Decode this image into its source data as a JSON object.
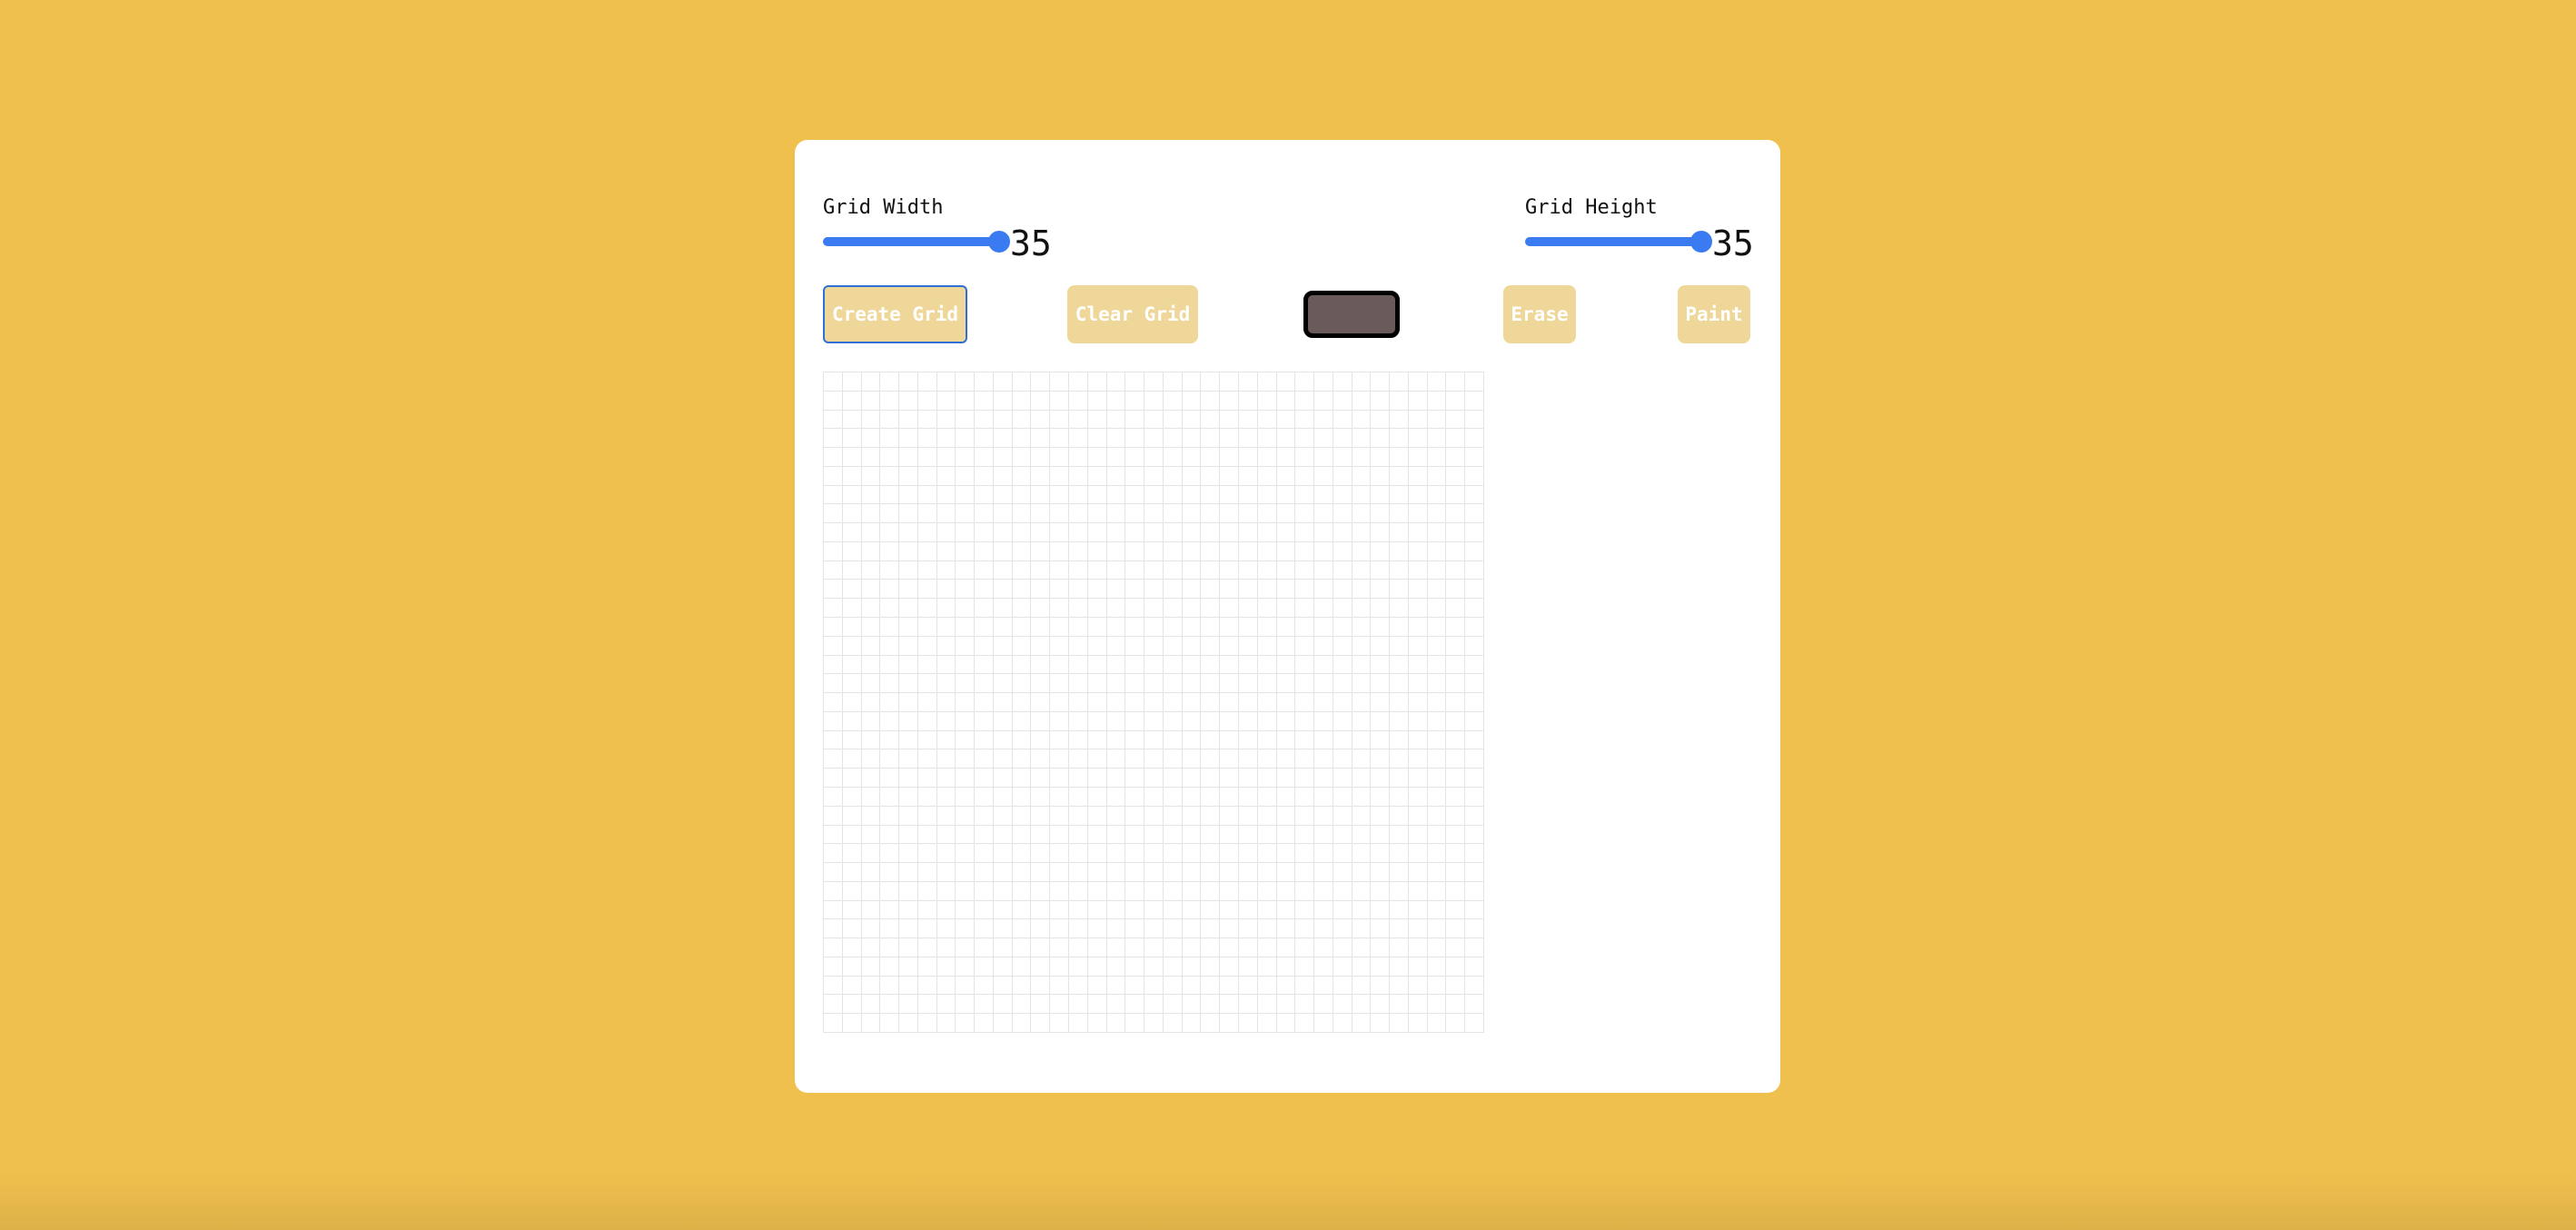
{
  "grid_width": {
    "label": "Grid Width",
    "value": "35"
  },
  "grid_height": {
    "label": "Grid Height",
    "value": "35"
  },
  "buttons": {
    "create_grid": "Create Grid",
    "clear_grid": "Clear Grid",
    "erase": "Erase",
    "paint": "Paint"
  },
  "color_picker": {
    "value": "#6b5a5a"
  },
  "grid": {
    "columns": 35,
    "rows": 35
  },
  "colors": {
    "background": "#f0c04e",
    "button": "#efd79a",
    "slider": "#3a7bf2",
    "grid_line": "#e4e4e4"
  }
}
